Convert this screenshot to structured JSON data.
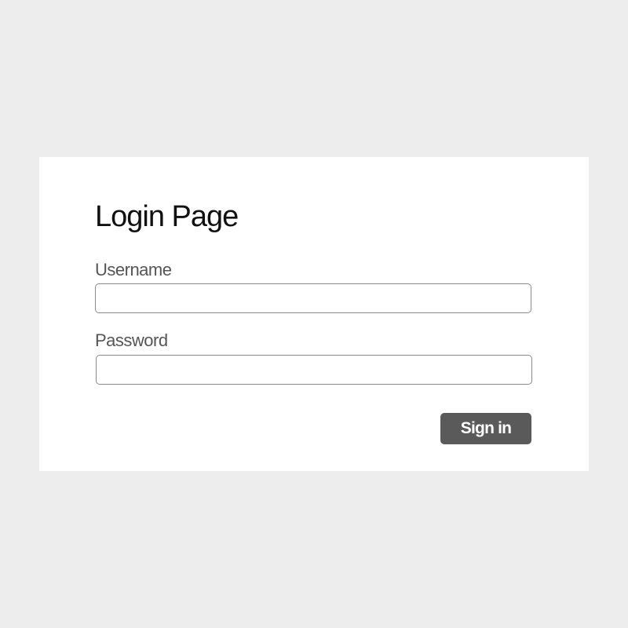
{
  "page": {
    "title": "Login Page"
  },
  "form": {
    "username": {
      "label": "Username",
      "value": "",
      "placeholder": ""
    },
    "password": {
      "label": "Password",
      "value": "",
      "placeholder": ""
    },
    "submit_label": "Sign in"
  },
  "colors": {
    "background": "#ededed",
    "card": "#ffffff",
    "button": "#5a5a5a",
    "button_text": "#ffffff",
    "label_text": "#555555",
    "title_text": "#111111",
    "input_border": "#8a8a8a"
  }
}
